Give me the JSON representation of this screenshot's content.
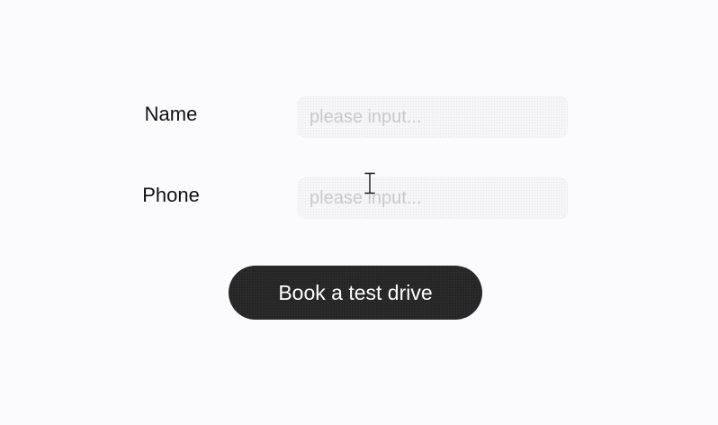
{
  "form": {
    "name": {
      "label": "Name",
      "placeholder": "please input...",
      "value": ""
    },
    "phone": {
      "label": "Phone",
      "placeholder": "please input...",
      "value": ""
    },
    "submit_label": "Book a test drive"
  },
  "cursor": {
    "icon": "text-cursor-icon"
  }
}
